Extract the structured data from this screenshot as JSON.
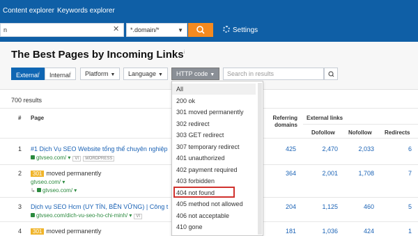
{
  "nav": {
    "items": [
      {
        "label": "Content explorer"
      },
      {
        "label": "Keywords explorer"
      }
    ]
  },
  "search": {
    "url_value": "n",
    "clear_icon": "✕",
    "mode_value": "*.domain/*",
    "settings_label": "Settings"
  },
  "page_title": "The Best Pages by Incoming Links",
  "page_title_sup": "i",
  "filters": {
    "external": "External",
    "internal": "Internal",
    "platform": "Platform",
    "language": "Language",
    "http_code": "HTTP code",
    "results_placeholder": "Search in results"
  },
  "results_count": "700 results",
  "table": {
    "headers": {
      "num": "#",
      "page": "Page",
      "referring_domains": "Referring domains",
      "external_links": "External links",
      "dofollow": "Dofollow",
      "nofollow": "Nofollow",
      "redirects": "Redirects"
    },
    "rows": [
      {
        "num": "1",
        "title": "#1 Dịch Vụ SEO Website tổng thể chuyên nghiệp",
        "url": "gtvseo.com/",
        "tags": [
          "VI",
          "WORDPRESS"
        ],
        "ref_domains": "425",
        "dofollow": "2,470",
        "nofollow": "2,033",
        "redirects": "6"
      },
      {
        "num": "2",
        "badge": "301",
        "title": "moved permanently",
        "url": "gtvseo.com/",
        "redirect_url": "gtvseo.com/",
        "ref_domains": "364",
        "dofollow": "2,001",
        "nofollow": "1,708",
        "redirects": "7"
      },
      {
        "num": "3",
        "title": "Dịch vụ SEO Hcm (UY TÍN, BỀN VỮNG) | Công t",
        "url": "gtvseo.com/dich-vu-seo-ho-chi-minh/",
        "tags": [
          "VI"
        ],
        "ref_domains": "204",
        "dofollow": "1,125",
        "nofollow": "460",
        "redirects": "5"
      },
      {
        "num": "4",
        "badge": "301",
        "title": "moved permanently",
        "ref_domains": "181",
        "dofollow": "1,036",
        "nofollow": "424",
        "redirects": "1"
      }
    ]
  },
  "http_dropdown": {
    "items": [
      "All",
      "200 ok",
      "301 moved permanently",
      "302 redirect",
      "303 GET redirect",
      "307 temporary redirect",
      "401 unauthorized",
      "402 payment required",
      "403 forbidden",
      "404 not found",
      "405 method not allowed",
      "406 not acceptable",
      "410 gone"
    ],
    "highlighted": "404 not found"
  },
  "colors": {
    "nav_blue": "#0f5fa6",
    "orange": "#f58a1f",
    "link_blue": "#1a62b5",
    "highlight_red": "#d0312d"
  }
}
